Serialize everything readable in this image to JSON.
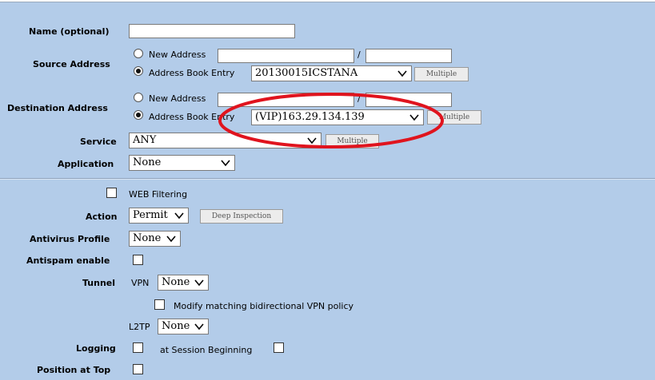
{
  "labels": {
    "name": "Name (optional)",
    "source_address": "Source Address",
    "destination_address": "Destination Address",
    "service": "Service",
    "application": "Application",
    "web_filtering": "WEB Filtering",
    "action": "Action",
    "antivirus_profile": "Antivirus Profile",
    "antispam_enable": "Antispam enable",
    "tunnel": "Tunnel",
    "vpn": "VPN",
    "modify_vpn": "Modify matching bidirectional VPN policy",
    "l2tp": "L2TP",
    "logging": "Logging",
    "at_session_beginning": "at Session Beginning",
    "position_at_top": "Position at Top"
  },
  "source": {
    "new_address_label": "New Address",
    "book_entry_label": "Address Book Entry",
    "book_entry_value": "20130015ICSTANA",
    "multiple_label": "Multiple",
    "slash": "/"
  },
  "destination": {
    "new_address_label": "New Address",
    "book_entry_label": "Address Book Entry",
    "book_entry_value": "(VIP)163.29.134.139",
    "multiple_label": "Multiple",
    "slash": "/"
  },
  "service": {
    "value": "ANY",
    "multiple_label": "Multiple"
  },
  "application": {
    "value": "None"
  },
  "action": {
    "value": "Permit",
    "deep_inspection_label": "Deep Inspection"
  },
  "antivirus": {
    "value": "None"
  },
  "vpn": {
    "value": "None"
  },
  "l2tp": {
    "value": "None"
  },
  "colors": {
    "background": "#b3cce9",
    "annotation": "#e0141e"
  }
}
